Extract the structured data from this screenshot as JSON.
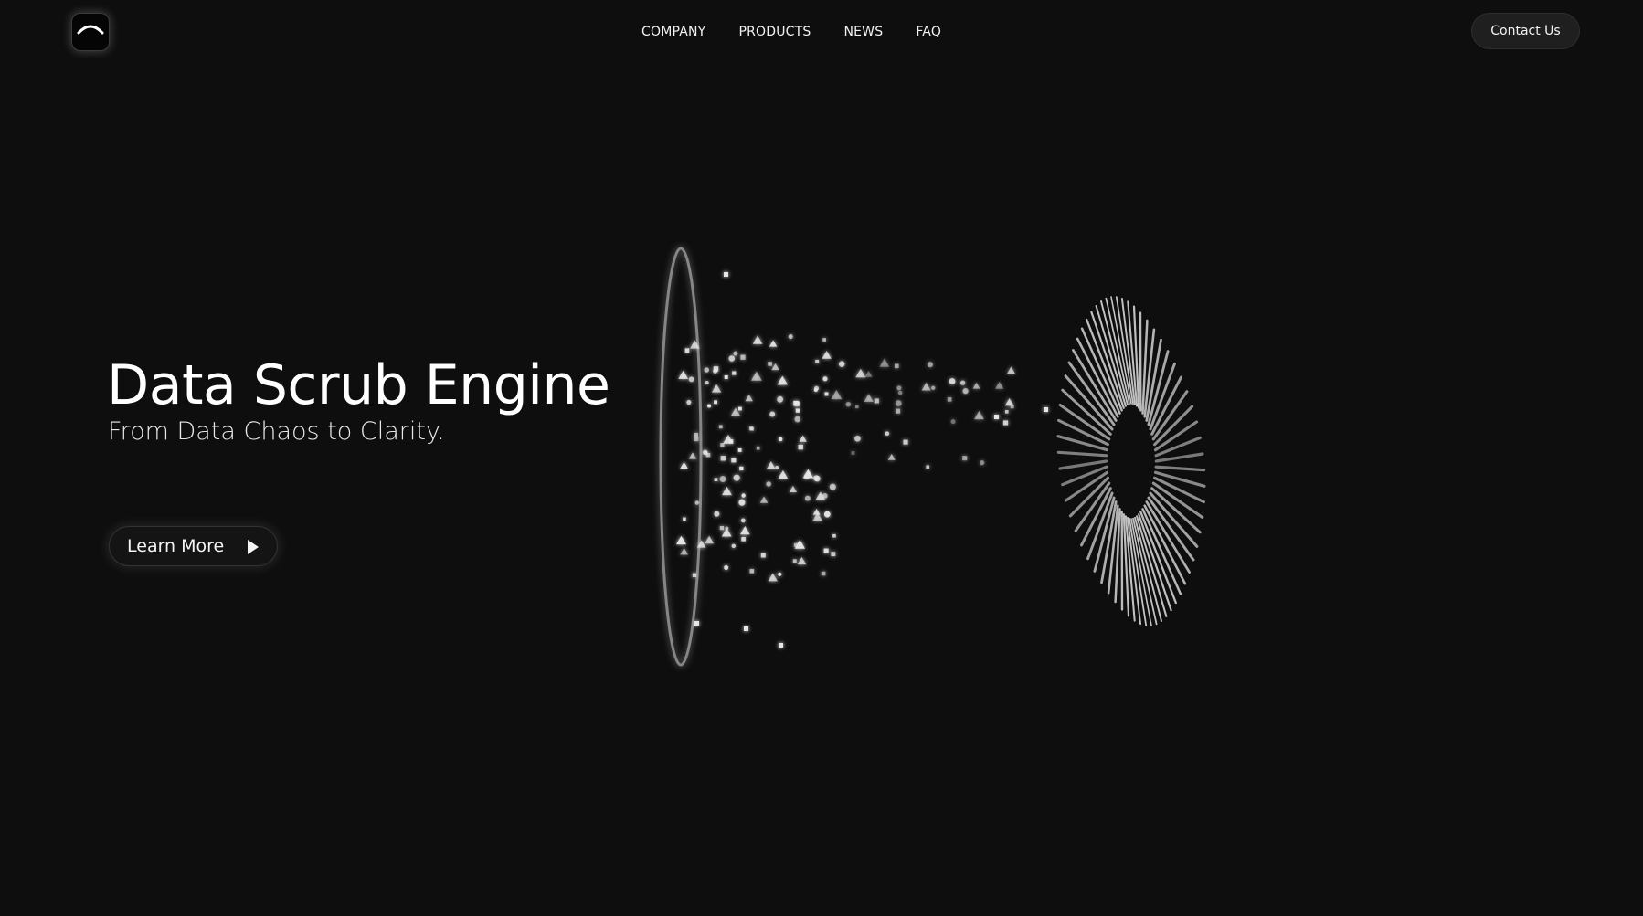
{
  "header": {
    "logo_icon": "arch-logo-icon",
    "nav": [
      {
        "label": "COMPANY"
      },
      {
        "label": "PRODUCTS"
      },
      {
        "label": "NEWS"
      },
      {
        "label": "FAQ"
      }
    ],
    "contact_label": "Contact Us"
  },
  "hero": {
    "title": "Data Scrub Engine",
    "subtitle": "From Data Chaos to Clarity.",
    "cta_label": "Learn More",
    "cta_icon": "play-icon"
  },
  "theme": {
    "background": "#0e0e0e",
    "text": "#ffffff",
    "button_bg": "#1f1f1f"
  }
}
